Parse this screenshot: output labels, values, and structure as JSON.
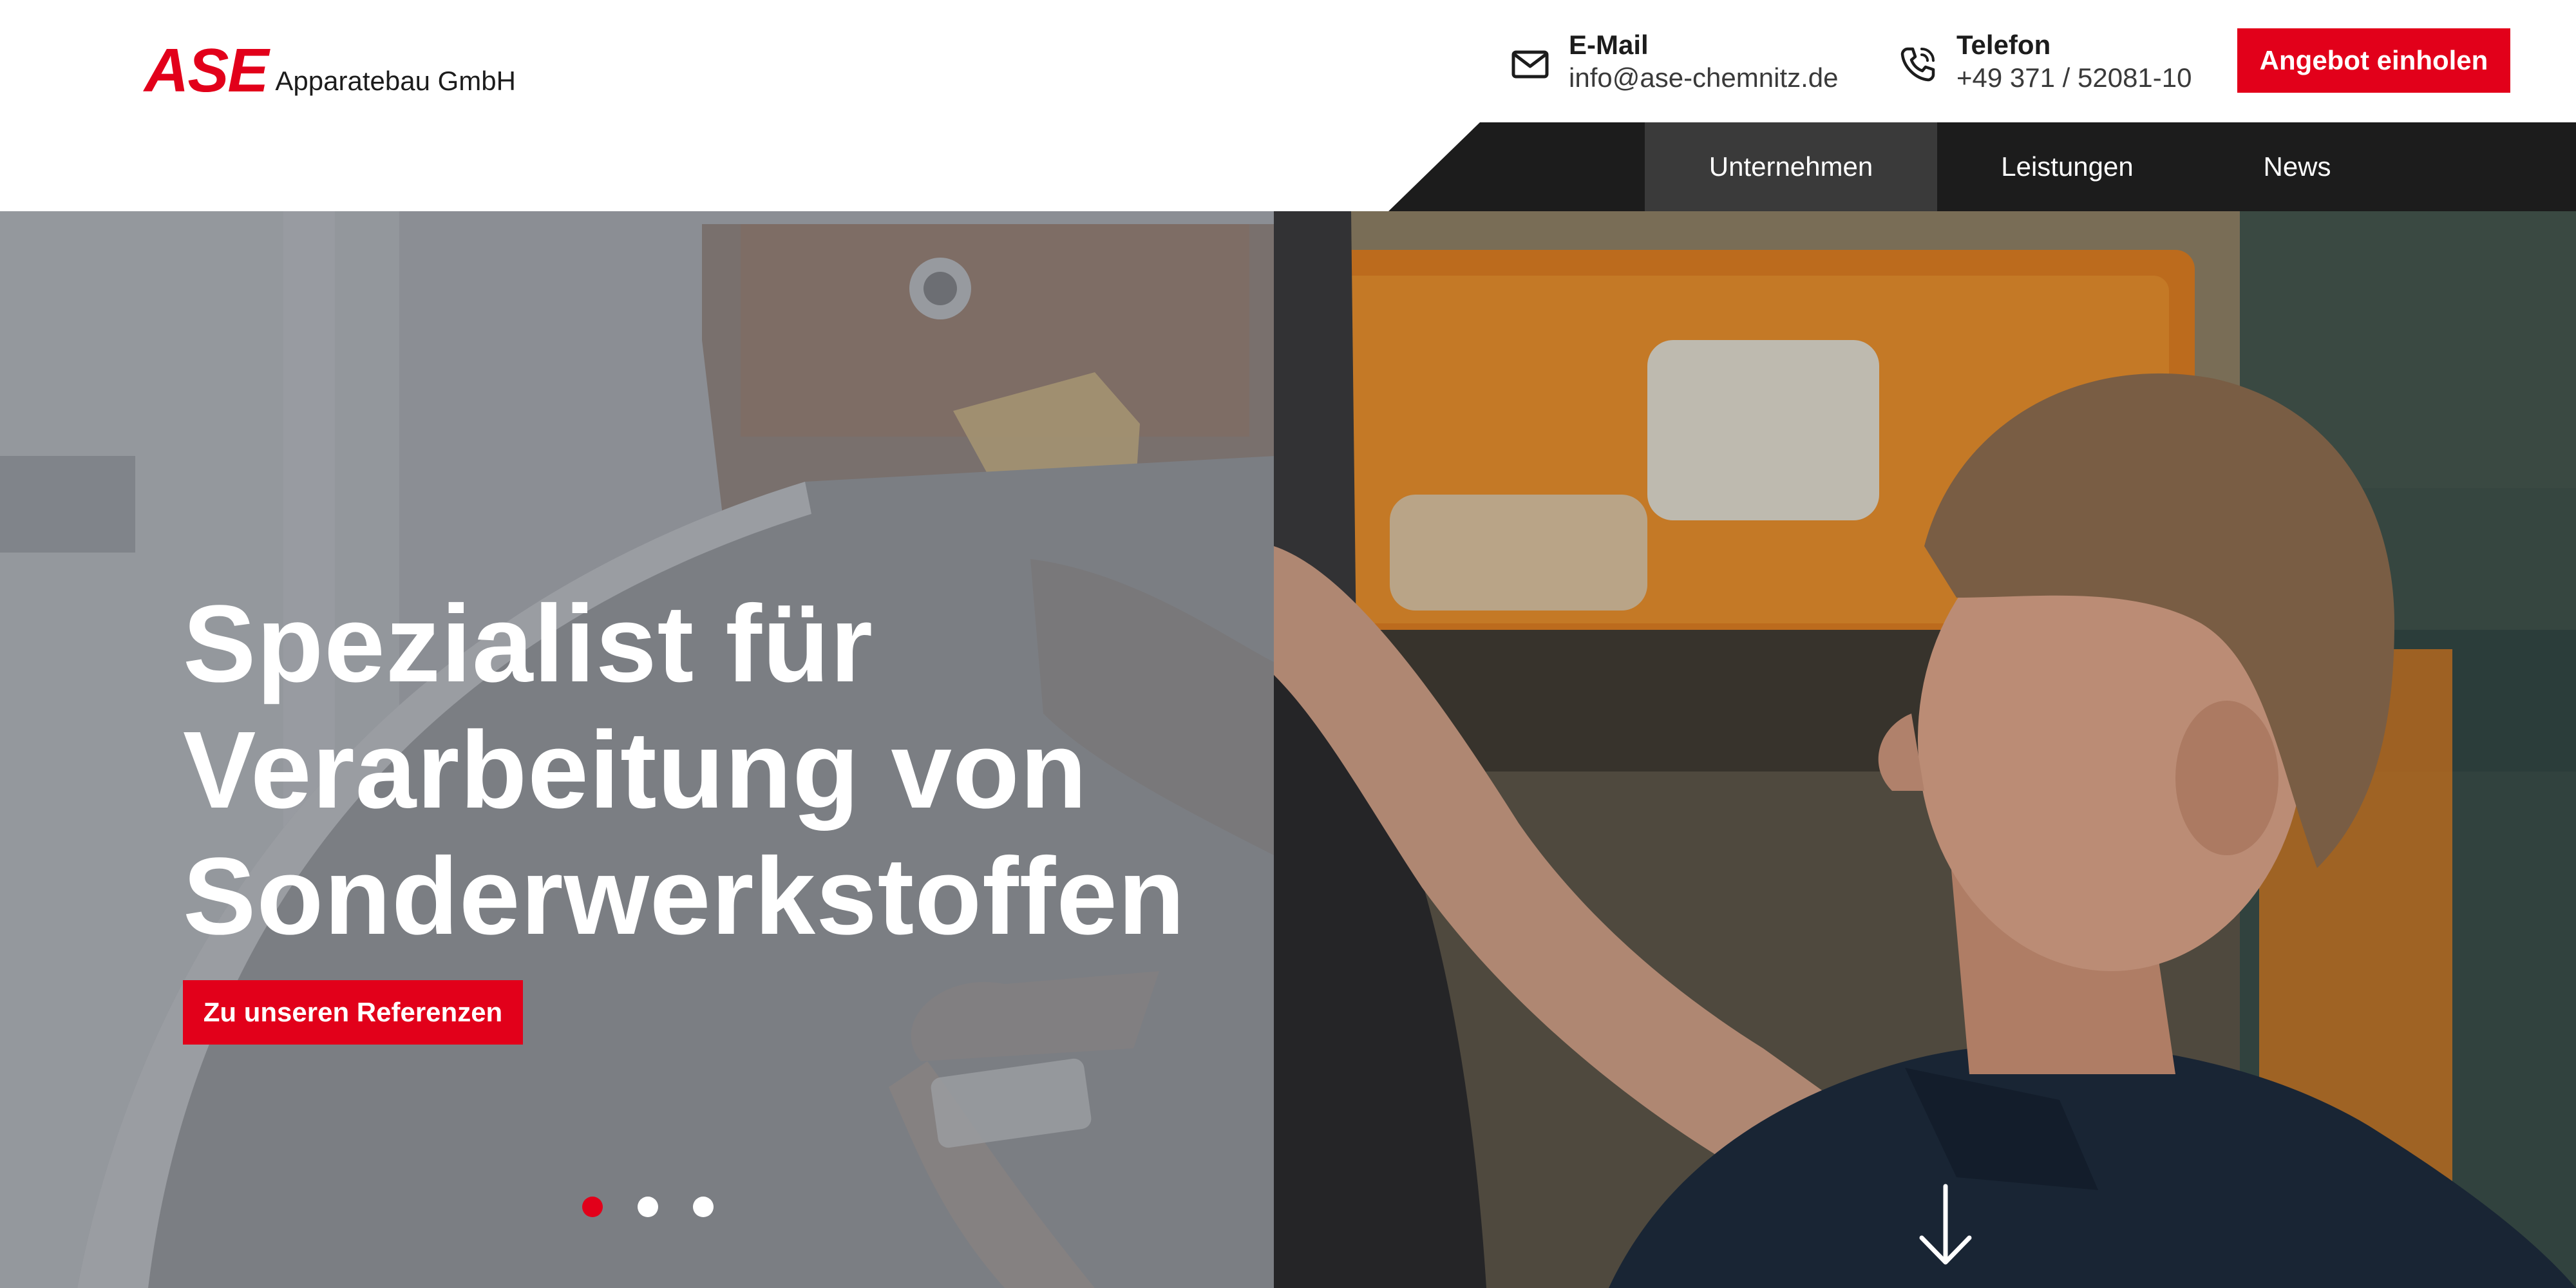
{
  "brand": {
    "mark": "ASE",
    "name": "Apparatebau GmbH",
    "accent_color": "#e2001a"
  },
  "contact": {
    "email": {
      "label": "E-Mail",
      "value": "info@ase-chemnitz.de",
      "icon": "mail-icon"
    },
    "phone": {
      "label": "Telefon",
      "value": "+49 371 / 52081-10",
      "icon": "phone-icon"
    }
  },
  "header_cta": {
    "label": "Angebot einholen"
  },
  "nav": {
    "items": [
      {
        "label": "Unternehmen",
        "active": true
      },
      {
        "label": "Leistungen",
        "active": false
      },
      {
        "label": "News",
        "active": false
      }
    ]
  },
  "hero": {
    "headline_lines": [
      "Spezialist für",
      "Verarbeitung von",
      "Sonderwerkstoffen"
    ],
    "button_label": "Zu unseren Referenzen",
    "slides": {
      "count": 3,
      "active_index": 0
    },
    "scroll_icon": "arrow-down-icon"
  }
}
